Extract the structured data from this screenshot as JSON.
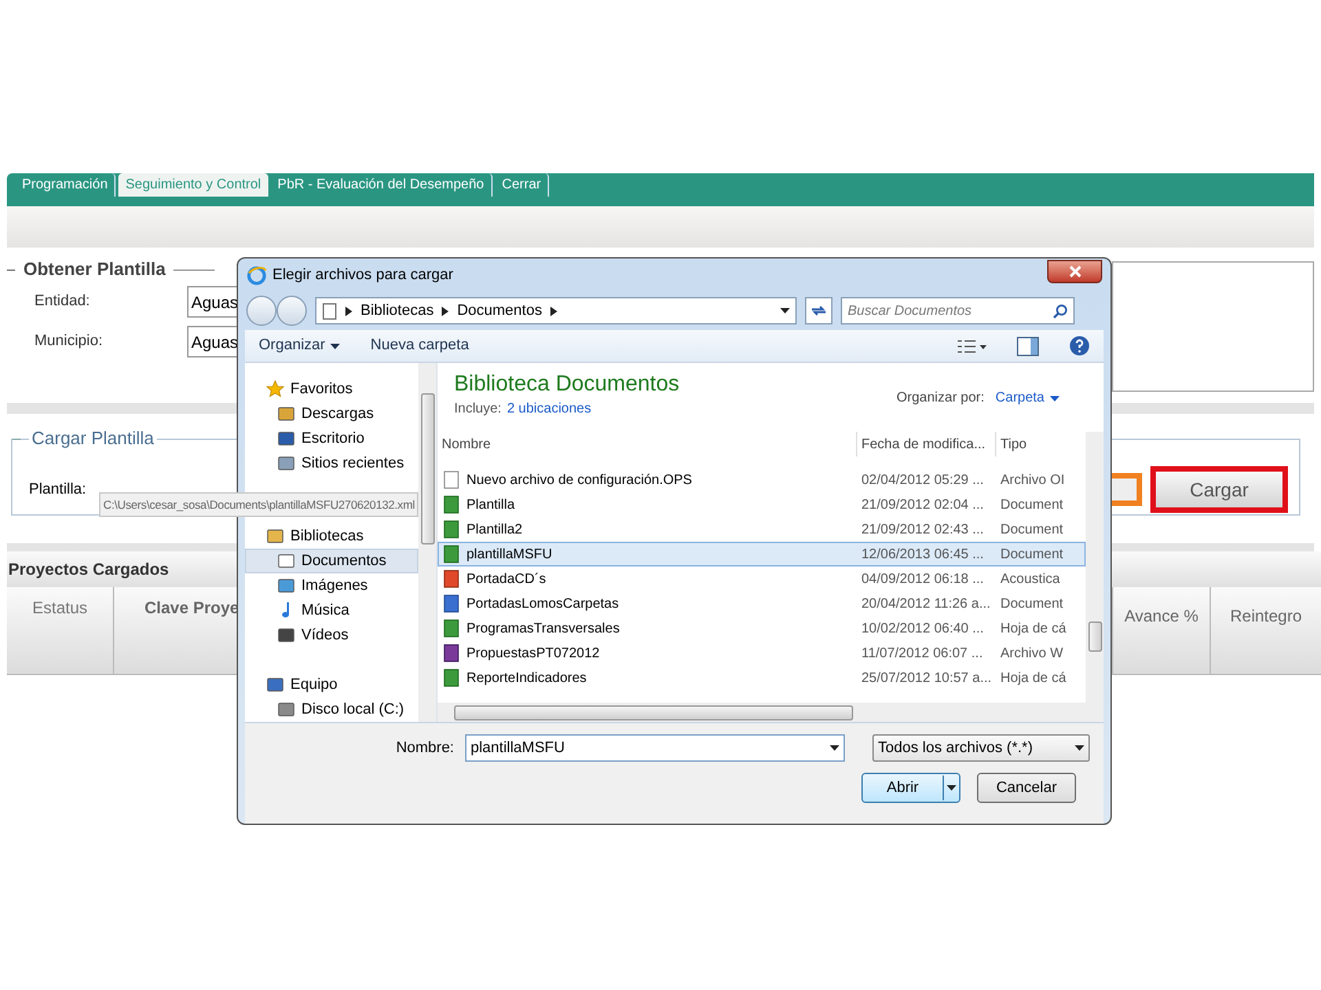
{
  "tabs": [
    {
      "label": "Programación",
      "selected": false
    },
    {
      "label": "Seguimiento y Control",
      "selected": true
    },
    {
      "label": "PbR - Evaluación del Desempeño",
      "selected": false
    },
    {
      "label": "Cerrar",
      "selected": false
    }
  ],
  "obtener": {
    "legend": "Obtener Plantilla",
    "fields": [
      {
        "label": "Entidad:",
        "value": "Aguas"
      },
      {
        "label": "Municipio:",
        "value": "Aguas"
      }
    ]
  },
  "cargar": {
    "legend": "Cargar Plantilla",
    "label": "Plantilla:",
    "path": "C:\\Users\\cesar_sosa\\Documents\\plantillaMSFU270620132.xml",
    "button": "Cargar"
  },
  "proyectos": {
    "title": "Proyectos Cargados",
    "columns": [
      "Estatus",
      "Clave Proye",
      "Avance %",
      "Reintegro"
    ]
  },
  "dialog": {
    "title": "Elegir archivos para cargar",
    "breadcrumb": [
      "Bibliotecas",
      "Documentos"
    ],
    "search_placeholder": "Buscar Documentos",
    "toolbar": [
      "Organizar",
      "Nueva carpeta"
    ],
    "nav": [
      {
        "label": "Favoritos",
        "kind": "star",
        "selected": false,
        "children": [
          {
            "label": "Descargas",
            "kind": "download",
            "selected": false
          },
          {
            "label": "Escritorio",
            "kind": "desktop",
            "selected": false
          },
          {
            "label": "Sitios recientes",
            "kind": "recent",
            "selected": false
          }
        ]
      },
      {
        "label": "Bibliotecas",
        "kind": "library",
        "selected": false,
        "children": [
          {
            "label": "Documentos",
            "kind": "document",
            "selected": true
          },
          {
            "label": "Imágenes",
            "kind": "image",
            "selected": false
          },
          {
            "label": "Música",
            "kind": "music",
            "selected": false
          },
          {
            "label": "Vídeos",
            "kind": "video",
            "selected": false
          }
        ]
      },
      {
        "label": "Equipo",
        "kind": "computer",
        "selected": false,
        "children": [
          {
            "label": "Disco local (C:)",
            "kind": "disk",
            "selected": false
          }
        ]
      }
    ],
    "library_title": "Biblioteca Documentos",
    "includes_label": "Incluye:",
    "includes_link": "2 ubicaciones",
    "arrange_label": "Organizar por:",
    "arrange_value": "Carpeta",
    "columns": [
      "Nombre",
      "Fecha de modifica...",
      "Tipo"
    ],
    "files": [
      {
        "name": "Nuevo archivo de configuración.OPS",
        "date": "02/04/2012 05:29 ...",
        "type": "Archivo OI",
        "kind": "blank",
        "selected": false
      },
      {
        "name": "Plantilla",
        "date": "21/09/2012 02:04 ...",
        "type": "Document",
        "kind": "excel",
        "selected": false
      },
      {
        "name": "Plantilla2",
        "date": "21/09/2012 02:43 ...",
        "type": "Document",
        "kind": "excel",
        "selected": false
      },
      {
        "name": "plantillaMSFU",
        "date": "12/06/2013 06:45 ...",
        "type": "Document",
        "kind": "excel",
        "selected": true
      },
      {
        "name": "PortadaCD´s",
        "date": "04/09/2012 06:18 ...",
        "type": "Acoustica",
        "kind": "media",
        "selected": false
      },
      {
        "name": "PortadasLomosCarpetas",
        "date": "20/04/2012 11:26 a...",
        "type": "Document",
        "kind": "word",
        "selected": false
      },
      {
        "name": "ProgramasTransversales",
        "date": "10/02/2012 06:40 ...",
        "type": "Hoja de cá",
        "kind": "excel",
        "selected": false
      },
      {
        "name": "PropuestasPT072012",
        "date": "11/07/2012 06:07 ...",
        "type": "Archivo W",
        "kind": "archive",
        "selected": false
      },
      {
        "name": "ReporteIndicadores",
        "date": "25/07/2012 10:57 a...",
        "type": "Hoja de cá",
        "kind": "excel",
        "selected": false
      }
    ],
    "filename_label": "Nombre:",
    "filename": "plantillaMSFU",
    "filter": "Todos los archivos (*.*)",
    "buttons": [
      "Abrir",
      "Cancelar"
    ]
  }
}
